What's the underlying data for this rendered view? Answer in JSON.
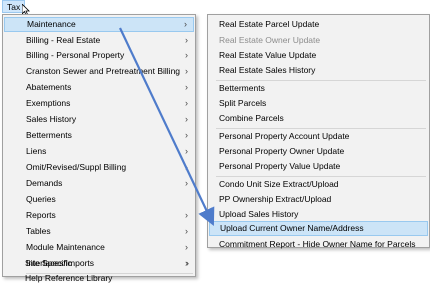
{
  "menubar": {
    "tax_label": "Tax"
  },
  "main_menu": {
    "items": [
      {
        "label": "Maintenance",
        "highlight": true,
        "has_submenu": true
      },
      {
        "label": "Billing - Real Estate",
        "has_submenu": true
      },
      {
        "label": "Billing - Personal Property",
        "has_submenu": true
      },
      {
        "label": "Cranston Sewer and Pretreatment Billing",
        "has_submenu": true
      },
      {
        "label": "Abatements",
        "has_submenu": true
      },
      {
        "label": "Exemptions",
        "has_submenu": true
      },
      {
        "label": "Sales History",
        "has_submenu": true
      },
      {
        "label": "Betterments",
        "has_submenu": true
      },
      {
        "label": "Liens",
        "has_submenu": true
      },
      {
        "label": "Omit/Revised/Suppl Billing",
        "has_submenu": true
      },
      {
        "label": "Demands",
        "has_submenu": true
      },
      {
        "label": "Queries",
        "has_submenu": false
      },
      {
        "label": "Reports",
        "has_submenu": true
      },
      {
        "label": "Tables",
        "has_submenu": true
      },
      {
        "label": "Module Maintenance",
        "has_submenu": true
      },
      {
        "label": "Interfaces/Imports",
        "has_submenu": true
      },
      {
        "label": "Site Specific",
        "has_submenu": true
      },
      {
        "label": "Help Reference Library",
        "has_submenu": false
      }
    ],
    "arrow_glyph": "›"
  },
  "sub_menu": {
    "items": [
      {
        "label": "Real Estate Parcel Update"
      },
      {
        "label": "Real Estate Owner Update",
        "disabled": true
      },
      {
        "label": "Real Estate Value Update"
      },
      {
        "label": "Real Estate Sales History"
      },
      {
        "label": "Betterments"
      },
      {
        "label": "Split Parcels"
      },
      {
        "label": "Combine Parcels"
      },
      {
        "label": "Personal Property Account Update"
      },
      {
        "label": "Personal Property Owner Update"
      },
      {
        "label": "Personal Property Value Update"
      },
      {
        "label": "Condo Unit Size Extract/Upload"
      },
      {
        "label": "PP Ownership Extract/Upload"
      },
      {
        "label": "Upload Sales History"
      },
      {
        "label": "Upload Current Owner Name/Address",
        "highlight": true
      },
      {
        "label": "Commitment Report - Hide Owner Name for Parcels"
      }
    ]
  },
  "colors": {
    "highlight": "#cce4f7",
    "arrow": "#4f7ccb"
  }
}
